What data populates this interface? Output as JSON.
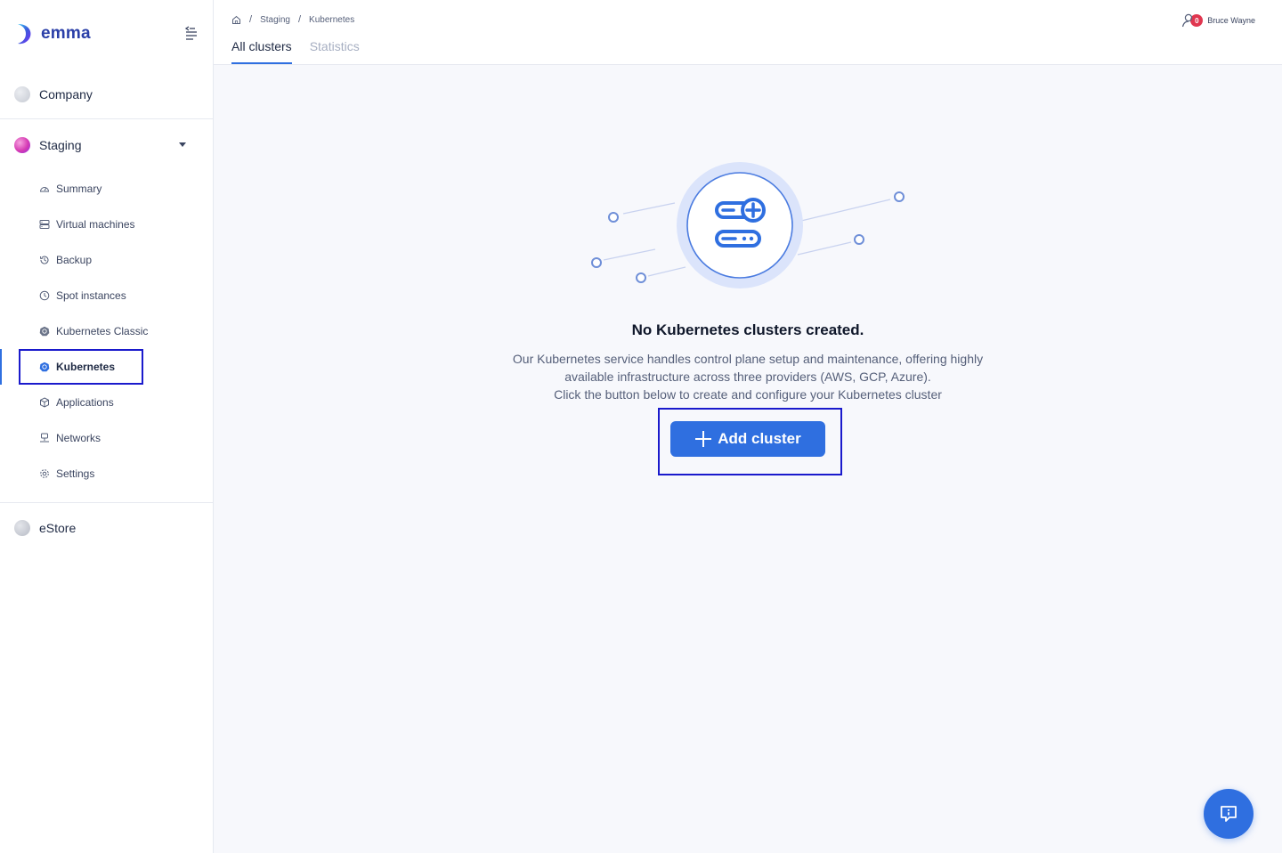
{
  "brand": {
    "name": "emma"
  },
  "sidebar": {
    "company": {
      "label": "Company",
      "color": "#d8dbe2"
    },
    "staging": {
      "label": "Staging",
      "items": [
        {
          "label": "Summary",
          "icon": "gauge-icon"
        },
        {
          "label": "Virtual machines",
          "icon": "server-icon"
        },
        {
          "label": "Backup",
          "icon": "history-icon"
        },
        {
          "label": "Spot instances",
          "icon": "clock-icon"
        },
        {
          "label": "Kubernetes Classic",
          "icon": "helm-icon"
        },
        {
          "label": "Kubernetes",
          "icon": "helm-icon",
          "active": true
        },
        {
          "label": "Applications",
          "icon": "cube-icon"
        },
        {
          "label": "Networks",
          "icon": "network-icon"
        },
        {
          "label": "Settings",
          "icon": "gear-icon"
        }
      ]
    },
    "estore": {
      "label": "eStore",
      "color": "#c9ccd4"
    }
  },
  "header": {
    "breadcrumb": [
      "Staging",
      "Kubernetes"
    ],
    "tabs": [
      {
        "label": "All clusters",
        "active": true
      },
      {
        "label": "Statistics",
        "active": false
      }
    ],
    "user": {
      "name": "Bruce Wayne",
      "notifications": "0"
    }
  },
  "empty_state": {
    "title": "No Kubernetes clusters created.",
    "description_lines": [
      "Our Kubernetes service handles control plane setup and maintenance, offering highly",
      "available infrastructure across three providers (AWS, GCP, Azure).",
      "Click the button below to create and configure your Kubernetes cluster"
    ],
    "button_label": "Add cluster"
  },
  "colors": {
    "accent": "#2f6fe0",
    "highlight": "#1a1acc",
    "badge": "#e0364f"
  }
}
